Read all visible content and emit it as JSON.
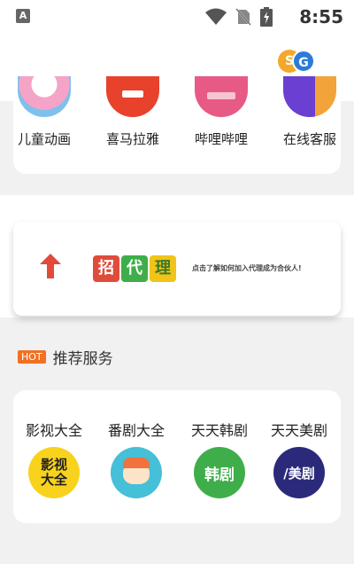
{
  "statusbar": {
    "notification_label": "A",
    "time": "8:55"
  },
  "header": {
    "logo_s": "S",
    "logo_g": "G"
  },
  "top_services": [
    {
      "label": "儿童动画",
      "icon": "cartoon-icon",
      "color": "#f5a3c7"
    },
    {
      "label": "喜马拉雅",
      "icon": "ximalaya-icon",
      "color": "#e8412c"
    },
    {
      "label": "哔哩哔哩",
      "icon": "bilibili-icon",
      "color": "#e85a86"
    },
    {
      "label": "在线客服",
      "icon": "support-icon",
      "color": "#6a3fd1"
    }
  ],
  "banner": {
    "chars": [
      "招",
      "代",
      "理"
    ],
    "char_colors": [
      "#e04c3c",
      "#3fae4a",
      "#f0c419"
    ],
    "text": "点击了解如何加入代理成为合伙人!"
  },
  "section": {
    "badge": "HOT",
    "title": "推荐服务"
  },
  "recommended": [
    {
      "label": "影视大全",
      "icon_text": "影视大全",
      "icon": "yingshi-icon",
      "color": "#f8d21c"
    },
    {
      "label": "番剧大全",
      "icon_text": "",
      "icon": "anime-icon",
      "color": "#46bfd8"
    },
    {
      "label": "天天韩剧",
      "icon_text": "韩剧",
      "icon": "korean-drama-icon",
      "color": "#3fae4a"
    },
    {
      "label": "天天美剧",
      "icon_text": "/美剧",
      "icon": "us-drama-icon",
      "color": "#2b2a7a"
    }
  ]
}
